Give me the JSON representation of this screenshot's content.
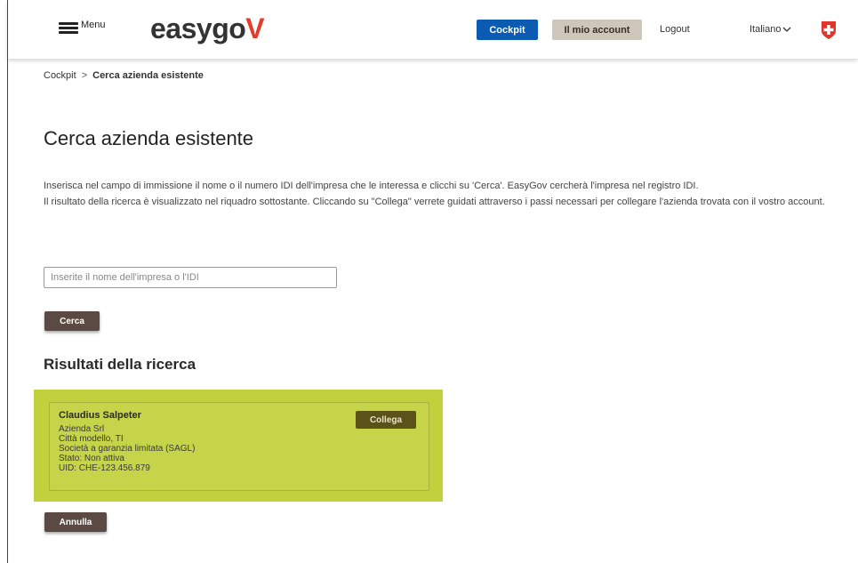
{
  "header": {
    "menu_label": "Menu",
    "logo_text": "easygo",
    "logo_accent": "V",
    "cockpit_label": "Cockpit",
    "account_label": "Il mio account",
    "logout_label": "Logout",
    "language": "Italiano"
  },
  "breadcrumb": {
    "root": "Cockpit",
    "separator": ">",
    "current": "Cerca azienda esistente"
  },
  "page": {
    "title": "Cerca azienda esistente",
    "intro_line1": "Inserisca nel campo di immissione il nome o il numero IDI dell'impresa che le interessa e clicchi su 'Cerca'. EasyGov cercherà l'impresa nel registro IDI.",
    "intro_line2": "Il risultato della ricerca è visualizzato nel riquadro sottostante. Cliccando su \"Collega\" verrete guidati attraverso i passi necessari per collegare l'azienda trovata con il vostro account."
  },
  "search": {
    "placeholder": "Inserite il nome dell'impresa o l'IDI",
    "value": "",
    "button_label": "Cerca"
  },
  "results": {
    "title": "Risultati della ricerca",
    "items": [
      {
        "name": "Claudius Salpeter",
        "company": "Azienda Srl",
        "city": "Città modello, TI",
        "legal_form": "Società a garanzia limitata (SAGL)",
        "status": "Stato: Non attiva",
        "uid": "UID: CHE-123.456.879",
        "action_label": "Collega"
      }
    ]
  },
  "footer": {
    "cancel_label": "Annulla"
  },
  "colors": {
    "cockpit_button": "#0b5bb3",
    "account_button": "#cfc6bb",
    "dark_button": "#5a4a43",
    "highlight": "#c1d13e",
    "logo_accent": "#e53a2c",
    "swiss_flag": "#e3342b"
  },
  "icons": {
    "menu": "hamburger-icon",
    "language_dropdown": "chevron-down-icon",
    "flag": "swiss-flag-icon"
  }
}
